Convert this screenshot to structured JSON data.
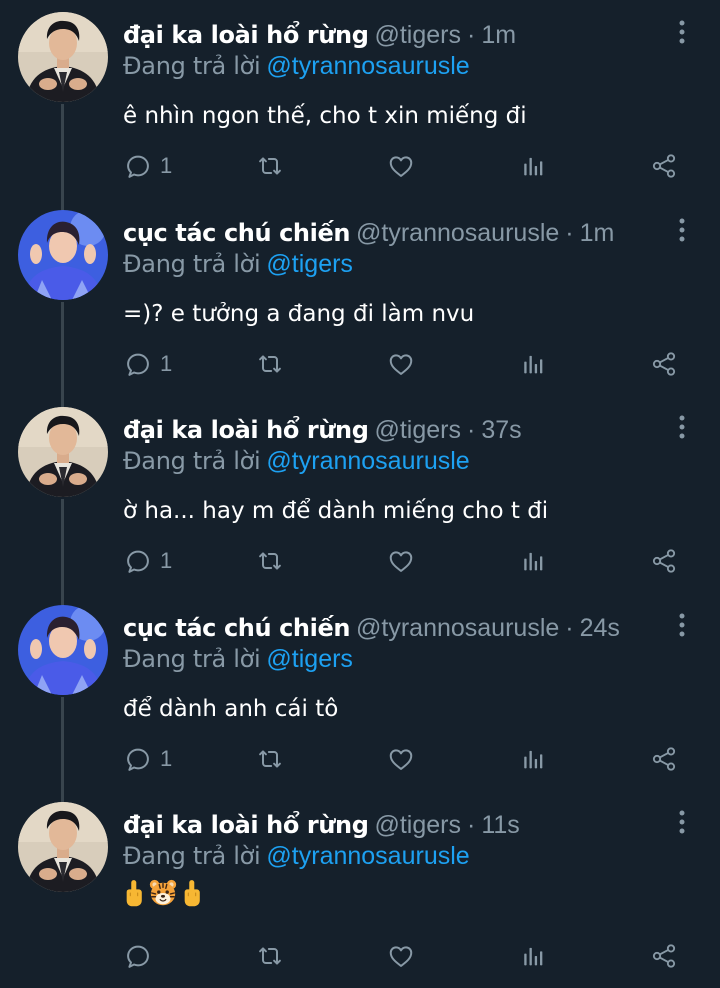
{
  "thread": {
    "replying_prefix": "Đang trả lời",
    "tweets": [
      {
        "author_name": "đại ka loài hổ rừng",
        "handle": "@tigers",
        "time": "1m",
        "reply_to": "@tyrannosaurusle",
        "text": "ê nhìn ngon thế, cho t xin miếng đi",
        "reply_count": "1",
        "avatar": "avatar-tigers"
      },
      {
        "author_name": "cục tác chú chiến",
        "handle": "@tyrannosaurusle",
        "time": "1m",
        "reply_to": "@tigers",
        "text": "=)? e tưởng a đang đi làm nvu",
        "reply_count": "1",
        "avatar": "avatar-tyrannosaurusle"
      },
      {
        "author_name": "đại ka loài hổ rừng",
        "handle": "@tigers",
        "time": "37s",
        "reply_to": "@tyrannosaurusle",
        "text": "ờ ha... hay m để dành miếng cho t đi",
        "reply_count": "1",
        "avatar": "avatar-tigers"
      },
      {
        "author_name": "cục tác chú chiến",
        "handle": "@tyrannosaurusle",
        "time": "24s",
        "reply_to": "@tigers",
        "text": "để dành anh cái tô",
        "reply_count": "1",
        "avatar": "avatar-tyrannosaurusle"
      },
      {
        "author_name": "đại ka loài hổ rừng",
        "handle": "@tigers",
        "time": "11s",
        "reply_to": "@tyrannosaurusle",
        "text": "",
        "emojis": [
          "middle-finger-emoji",
          "tiger-face-emoji",
          "middle-finger-emoji"
        ],
        "reply_count": "",
        "avatar": "avatar-tigers"
      }
    ]
  },
  "icons": {
    "more": "more-vertical-icon",
    "reply": "reply-icon",
    "retweet": "retweet-icon",
    "like": "heart-icon",
    "analytics": "analytics-icon",
    "share": "share-icon"
  },
  "colors": {
    "background": "#15202b",
    "text": "#ffffff",
    "secondary": "#8899a6",
    "mention": "#1da1f2",
    "thread_line": "#38444d"
  }
}
